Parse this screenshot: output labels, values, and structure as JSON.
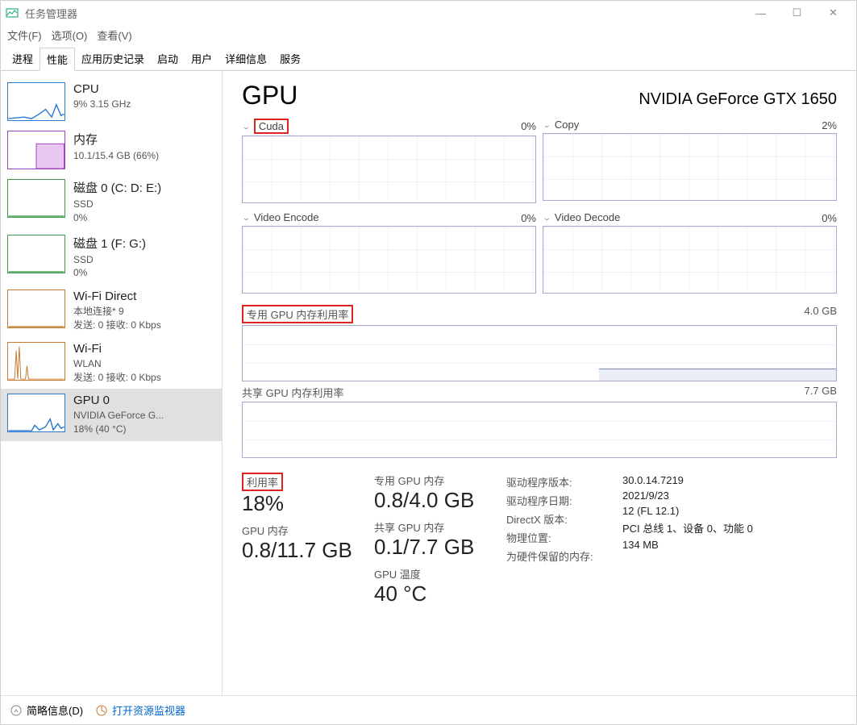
{
  "window": {
    "title": "任务管理器"
  },
  "window_controls": {
    "min": "—",
    "max": "☐",
    "close": "✕"
  },
  "menu": {
    "file": "文件(F)",
    "options": "选项(O)",
    "view": "查看(V)"
  },
  "tabs": {
    "processes": "进程",
    "performance": "性能",
    "app_history": "应用历史记录",
    "startup": "启动",
    "users": "用户",
    "details": "详细信息",
    "services": "服务"
  },
  "sidebar": {
    "cpu": {
      "title": "CPU",
      "sub": "9%  3.15 GHz"
    },
    "mem": {
      "title": "内存",
      "sub": "10.1/15.4 GB (66%)"
    },
    "disk0": {
      "title": "磁盘 0 (C: D: E:)",
      "sub1": "SSD",
      "sub2": "0%"
    },
    "disk1": {
      "title": "磁盘 1 (F: G:)",
      "sub1": "SSD",
      "sub2": "0%"
    },
    "wifi_d": {
      "title": "Wi-Fi Direct",
      "sub1": "本地连接* 9",
      "sub2": "发送: 0 接收: 0 Kbps"
    },
    "wifi": {
      "title": "Wi-Fi",
      "sub1": "WLAN",
      "sub2": "发送: 0 接收: 0 Kbps"
    },
    "gpu": {
      "title": "GPU 0",
      "sub1": "NVIDIA GeForce G...",
      "sub2": "18% (40 °C)"
    }
  },
  "gpu": {
    "heading": "GPU",
    "name": "NVIDIA GeForce GTX 1650",
    "engines": {
      "cuda": {
        "label": "Cuda",
        "val": "0%"
      },
      "copy": {
        "label": "Copy",
        "val": "2%"
      },
      "venc": {
        "label": "Video Encode",
        "val": "0%"
      },
      "vdec": {
        "label": "Video Decode",
        "val": "0%"
      }
    },
    "ded_mem": {
      "label": "专用 GPU 内存利用率",
      "max": "4.0 GB"
    },
    "shr_mem": {
      "label": "共享 GPU 内存利用率",
      "max": "7.7 GB"
    },
    "stats": {
      "util_label": "利用率",
      "util": "18%",
      "gpu_mem_label": "GPU 内存",
      "gpu_mem": "0.8/11.7 GB",
      "ded_label": "专用 GPU 内存",
      "ded": "0.8/4.0 GB",
      "shr_label": "共享 GPU 内存",
      "shr": "0.1/7.7 GB",
      "temp_label": "GPU 温度",
      "temp": "40 °C"
    },
    "info": {
      "driver_ver_l": "驱动程序版本:",
      "driver_ver": "30.0.14.7219",
      "driver_date_l": "驱动程序日期:",
      "driver_date": "2021/9/23",
      "dx_l": "DirectX 版本:",
      "dx": "12 (FL 12.1)",
      "loc_l": "物理位置:",
      "loc": "PCI 总线 1、设备 0、功能 0",
      "hw_res_l": "为硬件保留的内存:",
      "hw_res": "134 MB"
    }
  },
  "footer": {
    "brief": "简略信息(D)",
    "resmon": "打开资源监视器"
  }
}
